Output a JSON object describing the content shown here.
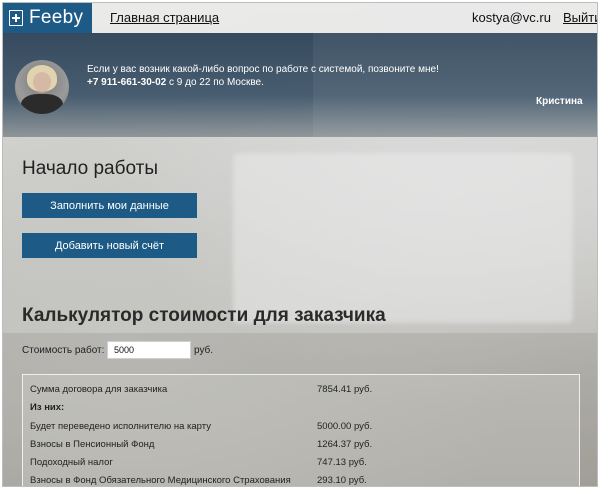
{
  "nav": {
    "logo_text": "Feeby",
    "home_link": "Главная страница",
    "user_email": "kostya@vc.ru",
    "logout": "Выйти"
  },
  "support": {
    "line1": "Если у вас возник какой-либо вопрос по работе с системой, позвоните мне!",
    "phone": "+7 911-661-30-02",
    "hours": " с 9 до 22 по Москве.",
    "name": "Кристина"
  },
  "start": {
    "title": "Начало работы",
    "fill_data_button": "Заполнить мои данные",
    "add_account_button": "Добавить новый счёт"
  },
  "calculator": {
    "title": "Калькулятор стоимости для заказчика",
    "cost_label": "Стоимость работ:",
    "cost_value": "5000",
    "cost_unit": "руб.",
    "rows": [
      {
        "label": "Сумма договора для заказчика",
        "value": "7854.41 руб."
      },
      {
        "label": "Из них:",
        "value": ""
      },
      {
        "label": "Будет переведено исполнителю на карту",
        "value": "5000.00 руб."
      },
      {
        "label": "Взносы в Пенсионный Фонд",
        "value": "1264.37 руб."
      },
      {
        "label": "Подоходный налог",
        "value": "747.13 руб."
      },
      {
        "label": "Взносы в Фонд Обязательного Медицинского Страхования",
        "value": "293.10 руб."
      }
    ]
  },
  "colors": {
    "brand": "#1d5b86",
    "button_text": "#ffffff"
  }
}
